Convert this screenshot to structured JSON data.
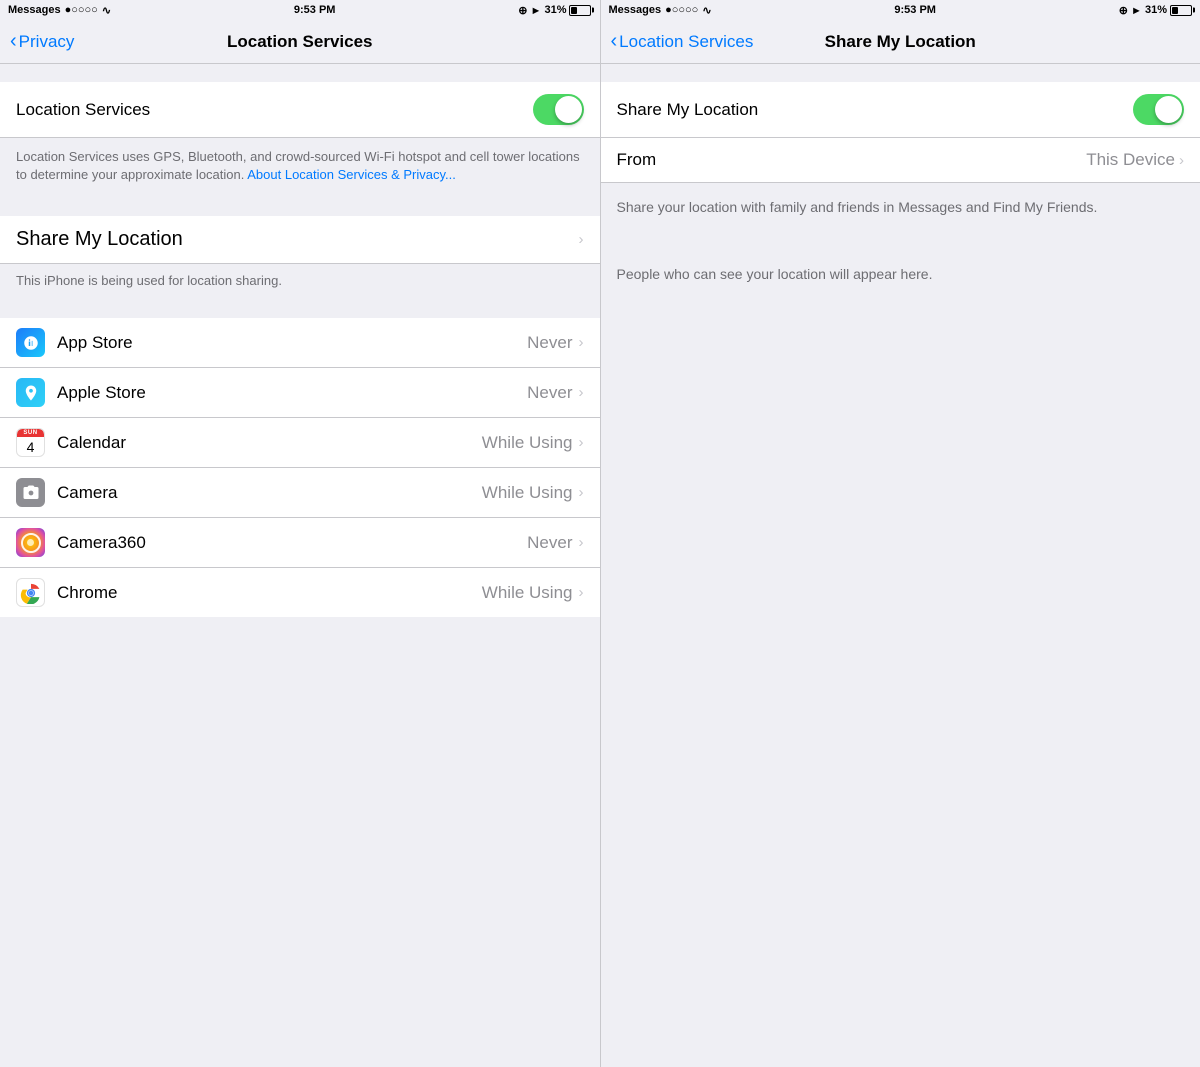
{
  "left": {
    "statusBar": {
      "app": "Messages",
      "signal": "●○○○○",
      "wifi": "WiFi",
      "time": "9:53 PM",
      "location": "⊕ ▶",
      "battery": "31%"
    },
    "navBack": "Privacy",
    "navTitle": "Location Services",
    "locationServices": {
      "label": "Location Services",
      "description": "Location Services uses GPS, Bluetooth, and crowd-sourced Wi-Fi hotspot and cell tower locations to determine your approximate location.",
      "linkText": "About Location Services & Privacy...",
      "toggleOn": true
    },
    "shareMyLocation": {
      "label": "Share My Location",
      "sublabel": "This iPhone is being used for location sharing."
    },
    "apps": [
      {
        "name": "App Store",
        "value": "Never",
        "iconType": "appstore"
      },
      {
        "name": "Apple Store",
        "value": "Never",
        "iconType": "applestore"
      },
      {
        "name": "Calendar",
        "value": "While Using",
        "iconType": "calendar"
      },
      {
        "name": "Camera",
        "value": "While Using",
        "iconType": "camera"
      },
      {
        "name": "Camera360",
        "value": "Never",
        "iconType": "camera360"
      },
      {
        "name": "Chrome",
        "value": "While Using",
        "iconType": "chrome"
      }
    ]
  },
  "right": {
    "statusBar": {
      "app": "Messages",
      "signal": "●○○○○",
      "wifi": "WiFi",
      "time": "9:53 PM",
      "location": "⊕ ▶",
      "battery": "31%"
    },
    "navBack": "Location Services",
    "navTitle": "Share My Location",
    "shareMyLocation": {
      "label": "Share My Location",
      "toggleOn": true
    },
    "from": {
      "label": "From",
      "value": "This Device"
    },
    "description": "Share your location with family and friends in Messages and Find My Friends.",
    "peopleText": "People who can see your location will appear here."
  }
}
